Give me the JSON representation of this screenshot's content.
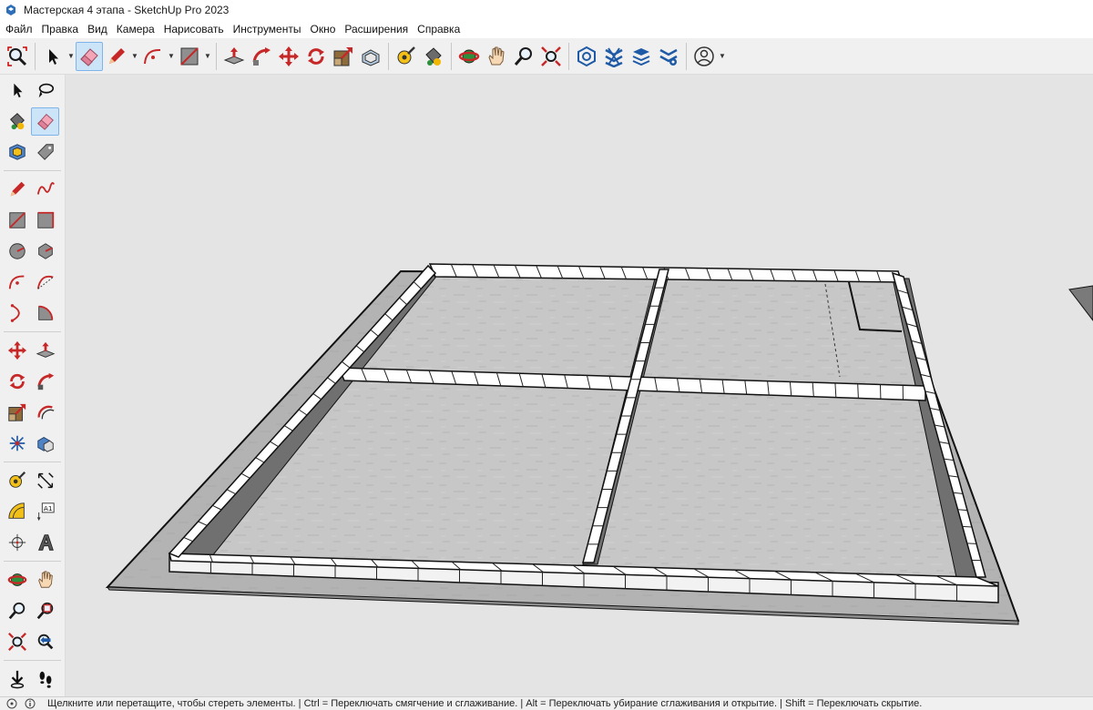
{
  "window": {
    "title": "Мастерская 4 этапа - SketchUp Pro 2023"
  },
  "menu": [
    "Файл",
    "Правка",
    "Вид",
    "Камера",
    "Нарисовать",
    "Инструменты",
    "Окно",
    "Расширения",
    "Справка"
  ],
  "toolbar": {
    "items": [
      "zoom-extents-icon",
      "select-icon",
      "eraser-icon",
      "pencil-icon",
      "arc-icon",
      "rectangle-icon",
      "push-pull-icon",
      "follow-me-icon",
      "move-icon",
      "rotate-icon",
      "scale-icon",
      "offset-icon",
      "tape-measure-icon",
      "paint-bucket-icon",
      "orbit-icon",
      "pan-icon",
      "zoom-icon",
      "zoom-window-icon",
      "warehouse-icon",
      "extension-warehouse-icon",
      "layout-icon",
      "extension-manager-icon",
      "profile-icon"
    ],
    "active": "eraser-icon"
  },
  "left_toolbar": {
    "active": "eraser-icon"
  },
  "colors": {
    "selected_bg": "#cce4f7",
    "selected_border": "#7eb4ea",
    "viewport_bg": "#e4e4e4",
    "floor": "#c6c6c6",
    "ground": "#b5b5b5",
    "wall_top": "#ffffff",
    "wall_side": "#707070"
  },
  "status": {
    "text": "Щелкните или перетащите, чтобы стереть элементы. | Ctrl = Переключать смягчение и сглаживание. | Alt = Переключать убирание сглаживания и открытие. | Shift = Переключать скрытие."
  }
}
